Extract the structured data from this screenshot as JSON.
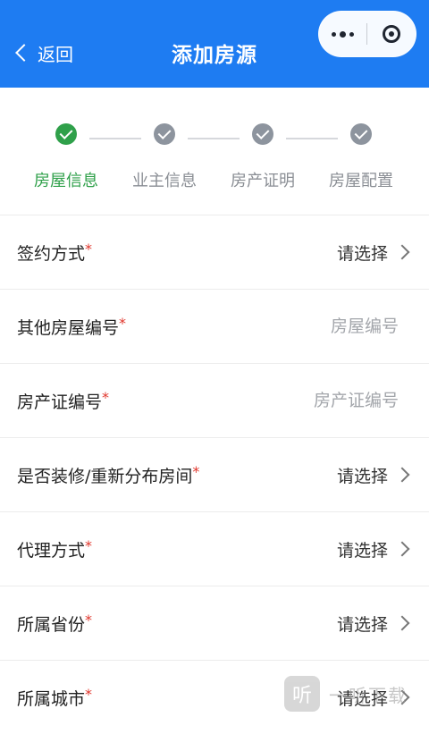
{
  "header": {
    "back_label": "返回",
    "title": "添加房源"
  },
  "steps": [
    {
      "label": "房屋信息",
      "state": "done"
    },
    {
      "label": "业主信息",
      "state": "pending"
    },
    {
      "label": "房产证明",
      "state": "pending"
    },
    {
      "label": "房屋配置",
      "state": "pending"
    }
  ],
  "form": {
    "rows": [
      {
        "label": "签约方式",
        "required": "*",
        "value": "请选择",
        "type": "select"
      },
      {
        "label": "其他房屋编号",
        "required": "*",
        "placeholder": "房屋编号",
        "type": "input"
      },
      {
        "label": "房产证编号",
        "required": "*",
        "placeholder": "房产证编号",
        "type": "input"
      },
      {
        "label": "是否装修/重新分布房间",
        "required": "*",
        "value": "请选择",
        "type": "select"
      },
      {
        "label": "代理方式",
        "required": "*",
        "value": "请选择",
        "type": "select"
      },
      {
        "label": "所属省份",
        "required": "*",
        "value": "请选择",
        "type": "select"
      },
      {
        "label": "所属城市",
        "required": "*",
        "value": "请选择",
        "type": "select"
      }
    ]
  },
  "watermark": {
    "logo_text": "听",
    "text": "一听下载"
  },
  "colors": {
    "header_bg": "#1e7cf2",
    "step_active": "#2fa04a",
    "step_inactive": "#8d949e",
    "required": "#e0362c"
  }
}
